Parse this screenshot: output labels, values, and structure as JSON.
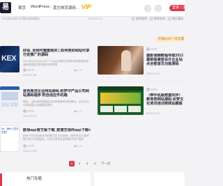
{
  "header": {
    "logo_glyph": "易",
    "nav": [
      {
        "label": "首页"
      },
      {
        "label": "WordPress",
        "chevron": "⌄"
      },
      {
        "label": "其它网页源码",
        "chevron": "⌄"
      }
    ],
    "vip_label": "VIP",
    "login_label": "登录 / 注册"
  },
  "notice": {
    "text": "2023年08月12日随访网站建设",
    "date": "2023-02-14"
  },
  "toolbar": [
    {
      "label": "使用说明"
    },
    {
      "label": "售前咨询"
    },
    {
      "label": "售后服务"
    }
  ],
  "promo_label": "开通SVIP一年仅需",
  "cards": [
    {
      "thumb_text": "KEX",
      "title": "好站_全网可整套购买 | 如何用好网站可享付定推广的源码",
      "desc": "2023年5月15日可开个人认证店铺站内需求表和查看更多请来查找商品和网站技术热搜",
      "author": "admin",
      "date": "2023-11-08",
      "views": "1",
      "likes": "0"
    },
    {
      "thumb_text": "",
      "title": "摄影课题教程导航2012最新版兼容设计企业站点全部首页功能源码",
      "desc": "",
      "author": "admin",
      "date": "2023-10-20",
      "views": "0",
      "likes": "0"
    },
    {
      "thumb_text": "",
      "title": "蓝色简洁企业网站源码 织梦中产品公司网站源码程序 附自适应手机端",
      "desc": "做生，当然请再看某购买到你想要的网站源码，适合企业内网站展示店铺网站源码",
      "author": "admin",
      "date": "2023-10-23",
      "views": "0",
      "likes": "0"
    },
    {
      "thumb_text": "",
      "title": "（带手机版数据同步）教育类网站源码 织梦文化资讯培训类网站模板",
      "desc": "",
      "author": "admin",
      "date": "2023-10-11",
      "views": "0",
      "likes": "0"
    },
    {
      "thumb_text": "Mr.. 源码_首页定制",
      "title": "欧易app官方版下载_欧意交易所app下载v6.8.42",
      "desc": "欧易平台是全球领先的数字货币交易所，提供安全可靠的数字资产交易服务，为用户提供全面的数字资产服务",
      "author": "admin",
      "date": "2023-10-25",
      "views": "0",
      "likes": "0"
    }
  ],
  "pagination": {
    "pages": [
      "1",
      "2",
      "3",
      "4"
    ],
    "active": "1",
    "next_label": "下一页"
  },
  "footer": {
    "title": "热门专题"
  }
}
